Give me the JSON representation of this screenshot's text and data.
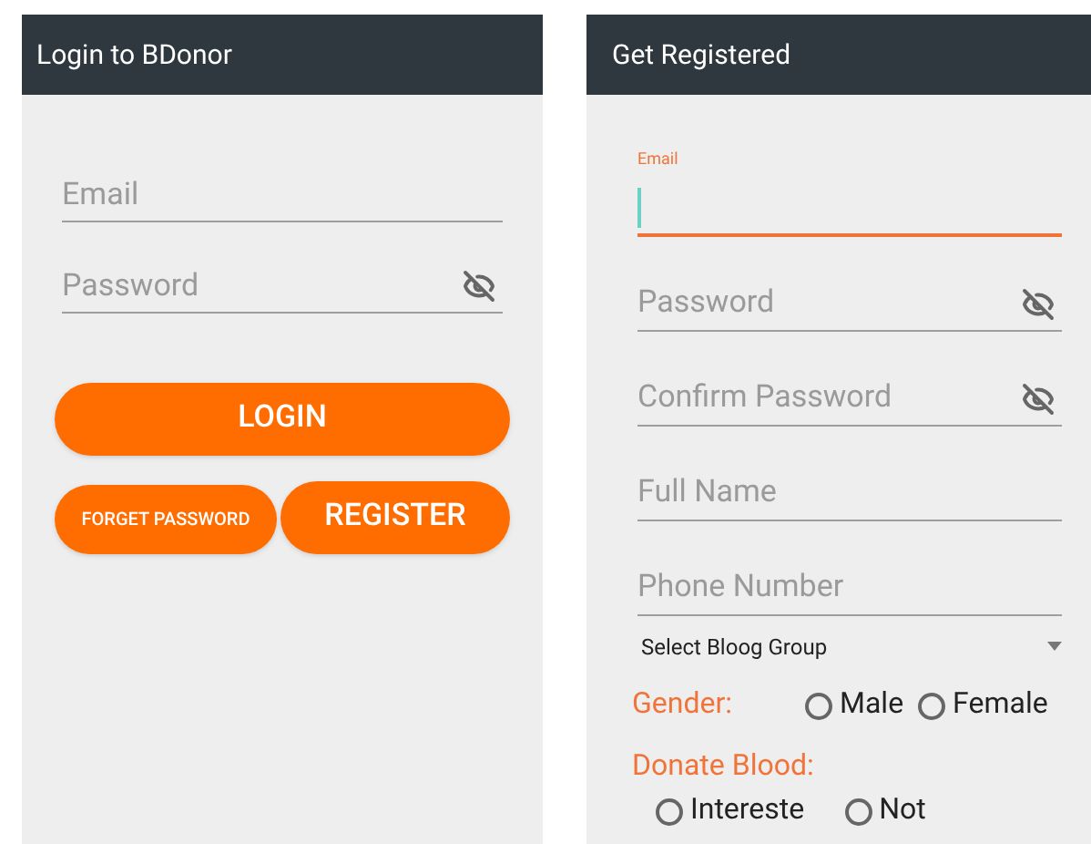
{
  "login": {
    "title": "Login to BDonor",
    "fields": [
      {
        "placeholder": "Email",
        "kind": "text"
      },
      {
        "placeholder": "Password",
        "kind": "password"
      }
    ],
    "primary_button": "LOGIN",
    "secondary_buttons": [
      {
        "label": "FORGET PASSWORD",
        "kind": "small"
      },
      {
        "label": "REGISTER",
        "kind": "large"
      }
    ]
  },
  "register": {
    "title": "Get Registered",
    "fields": [
      {
        "label": "Email",
        "kind": "text",
        "focused": true
      },
      {
        "placeholder": "Password",
        "kind": "password",
        "focused": false
      },
      {
        "placeholder": "Confirm Password",
        "kind": "password",
        "focused": false
      },
      {
        "placeholder": "Full Name",
        "kind": "text",
        "focused": false
      },
      {
        "placeholder": "Phone Number",
        "kind": "text",
        "focused": false
      }
    ],
    "select": {
      "value": "Select Bloog Group"
    },
    "gender": {
      "label": "Gender:",
      "options": [
        {
          "label": "Male",
          "selected": false
        },
        {
          "label": "Female",
          "selected": false
        }
      ]
    },
    "donate": {
      "label": "Donate Blood:",
      "options": [
        {
          "label": "Intereste",
          "selected": false
        },
        {
          "label": "Not",
          "selected": false
        }
      ]
    }
  }
}
